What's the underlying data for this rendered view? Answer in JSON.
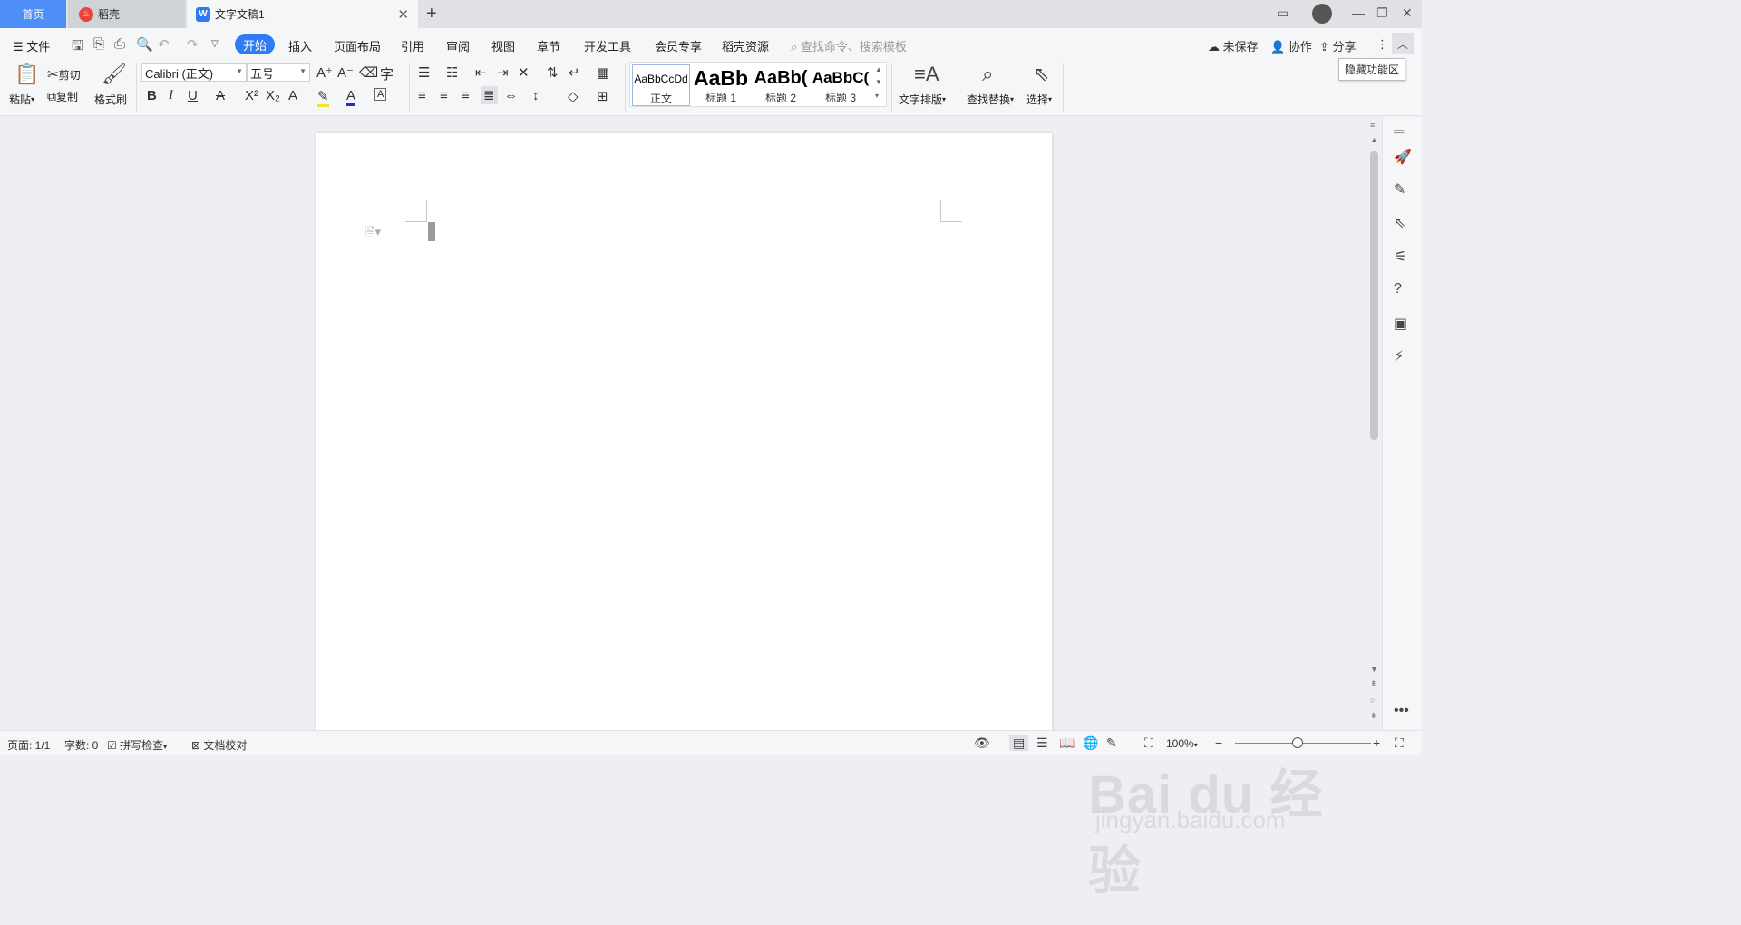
{
  "tabs": {
    "home": "首页",
    "daoke": "稻壳",
    "doc": "文字文稿1"
  },
  "menu": {
    "file": "文件",
    "start": "开始",
    "insert": "插入",
    "layout": "页面布局",
    "references": "引用",
    "review": "审阅",
    "view": "视图",
    "section": "章节",
    "devtools": "开发工具",
    "member": "会员专享",
    "daoke_res": "稻壳资源",
    "search_placeholder": "查找命令、搜索模板",
    "unsaved": "未保存",
    "collab": "协作",
    "share": "分享"
  },
  "tooltip": "隐藏功能区",
  "tools": {
    "paste": "粘贴",
    "cut": "剪切",
    "copy": "复制",
    "format_painter": "格式刷",
    "font_name": "Calibri (正文)",
    "font_size": "五号",
    "styles": [
      {
        "sample": "AaBbCcDd",
        "label": "正文"
      },
      {
        "sample": "AaBb",
        "label": "标题 1"
      },
      {
        "sample": "AaBb(",
        "label": "标题 2"
      },
      {
        "sample": "AaBbC(",
        "label": "标题 3"
      }
    ],
    "text_layout": "文字排版",
    "find_replace": "查找替换",
    "select": "选择"
  },
  "status": {
    "page": "页面: 1/1",
    "words": "字数: 0",
    "spell": "拼写检查",
    "proofread": "文档校对",
    "zoom": "100%"
  },
  "watermark": {
    "logo": "Bai du 经验",
    "url": "jingyan.baidu.com"
  }
}
